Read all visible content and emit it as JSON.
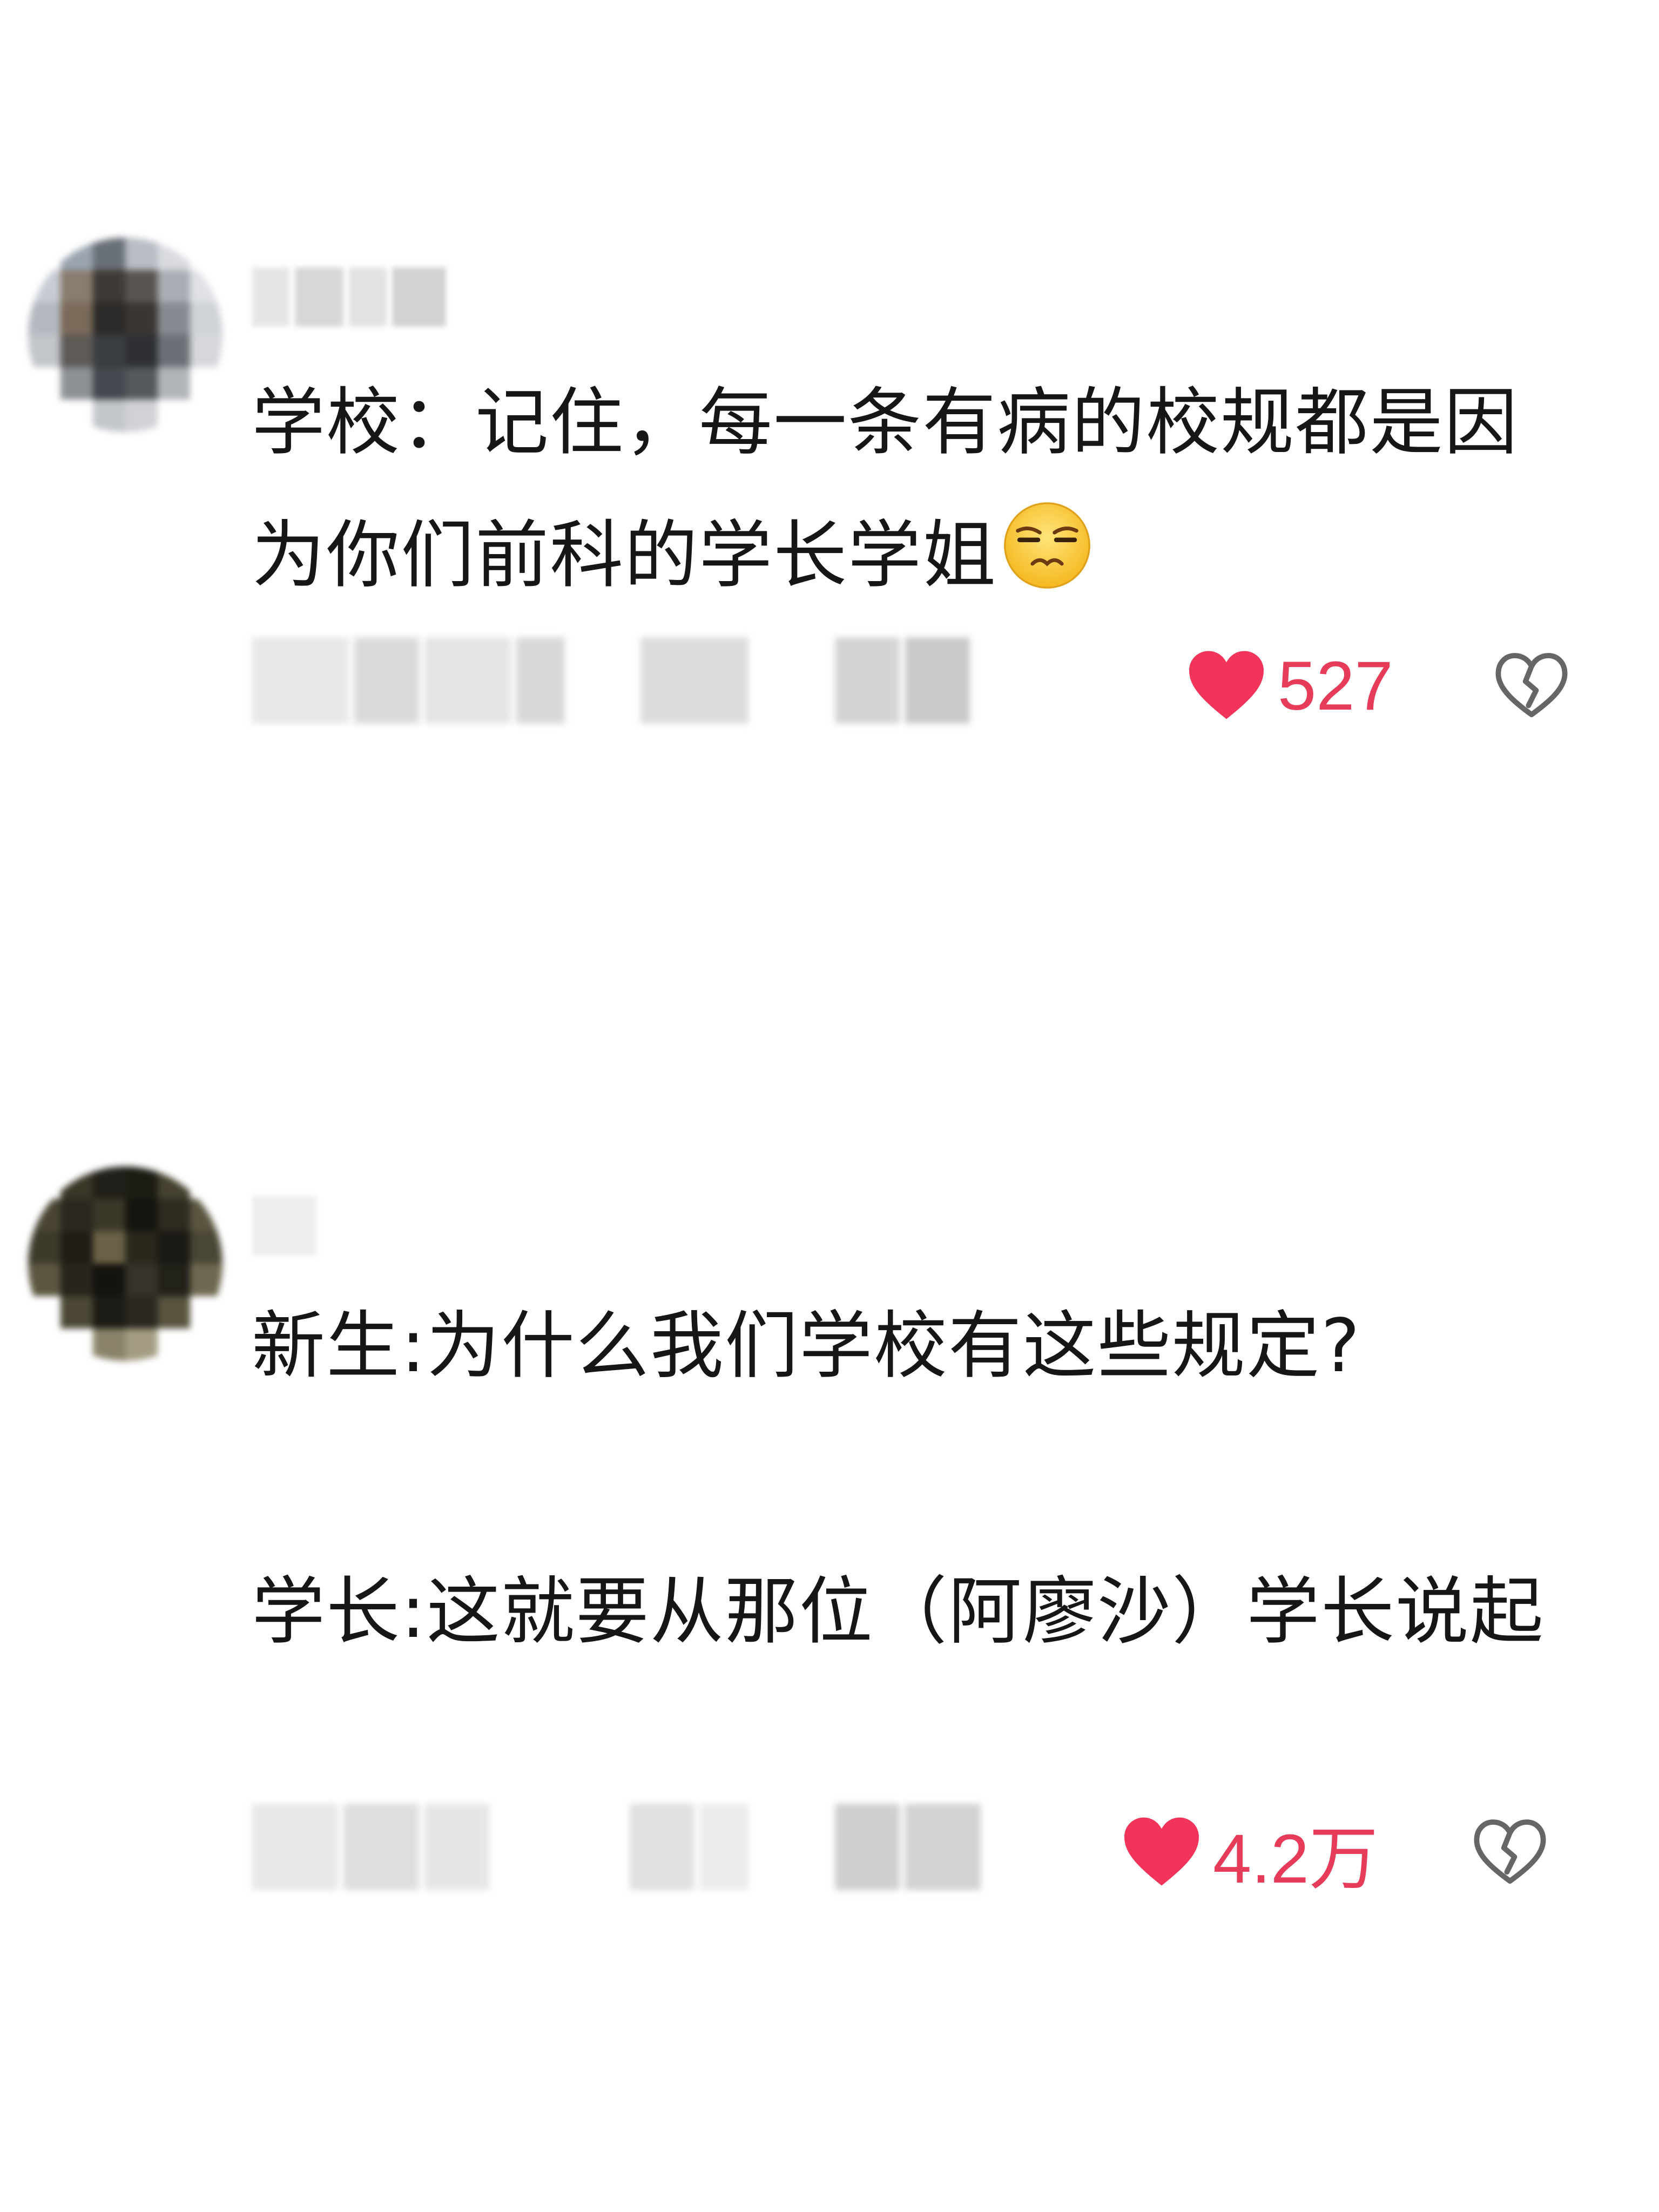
{
  "comments": [
    {
      "text": "学校：记住，每一条有病的校规都是因为你们前科的学长学姐",
      "emoji": "squinting-face-emoji",
      "likes": "527",
      "like_icon": "heart-icon",
      "dislike_icon": "broken-heart-icon",
      "like_color": "#e63c5a"
    },
    {
      "text": "新生:为什么我们学校有这些规定?\n\n学长:这就要从那位（阿廖沙）学长说起",
      "likes": "4.2万",
      "like_icon": "heart-icon",
      "dislike_icon": "broken-heart-icon",
      "like_color": "#e63c5a"
    }
  ]
}
